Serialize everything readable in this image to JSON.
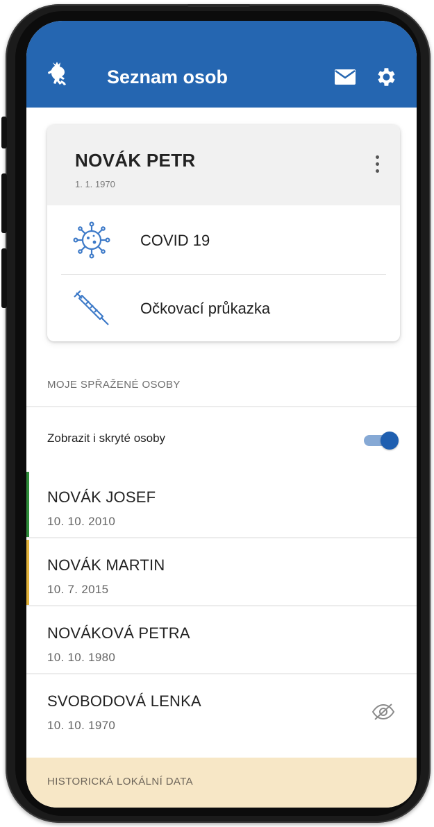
{
  "header": {
    "title": "Seznam osob",
    "logo_icon": "czech-lion-icon",
    "mail_icon": "mail-icon",
    "settings_icon": "gear-icon",
    "bar_color": "#2566b1"
  },
  "main_person": {
    "name": "NOVÁK PETR",
    "dob": "1. 1. 1970",
    "items": [
      {
        "label": "COVID 19",
        "icon": "virus-icon"
      },
      {
        "label": "Očkovací průkazka",
        "icon": "syringe-icon"
      }
    ]
  },
  "linked": {
    "section_title": "MOJE SPŘAŽENÉ OSOBY",
    "toggle_label": "Zobrazit i skryté osoby",
    "toggle_on": true,
    "persons": [
      {
        "name": "NOVÁK JOSEF",
        "dob": "10. 10. 2010",
        "accent": "#2e8b3a"
      },
      {
        "name": "NOVÁK MARTIN",
        "dob": "10. 7. 2015",
        "accent": "#e2b23a"
      },
      {
        "name": "NOVÁKOVÁ PETRA",
        "dob": "10. 10. 1980",
        "accent": ""
      },
      {
        "name": "SVOBODOVÁ LENKA",
        "dob": "10. 10. 1970",
        "accent": "",
        "hidden_icon": "eye-off-icon"
      }
    ]
  },
  "footer": {
    "label": "HISTORICKÁ LOKÁLNÍ DATA",
    "color": "#f7e7c6"
  }
}
